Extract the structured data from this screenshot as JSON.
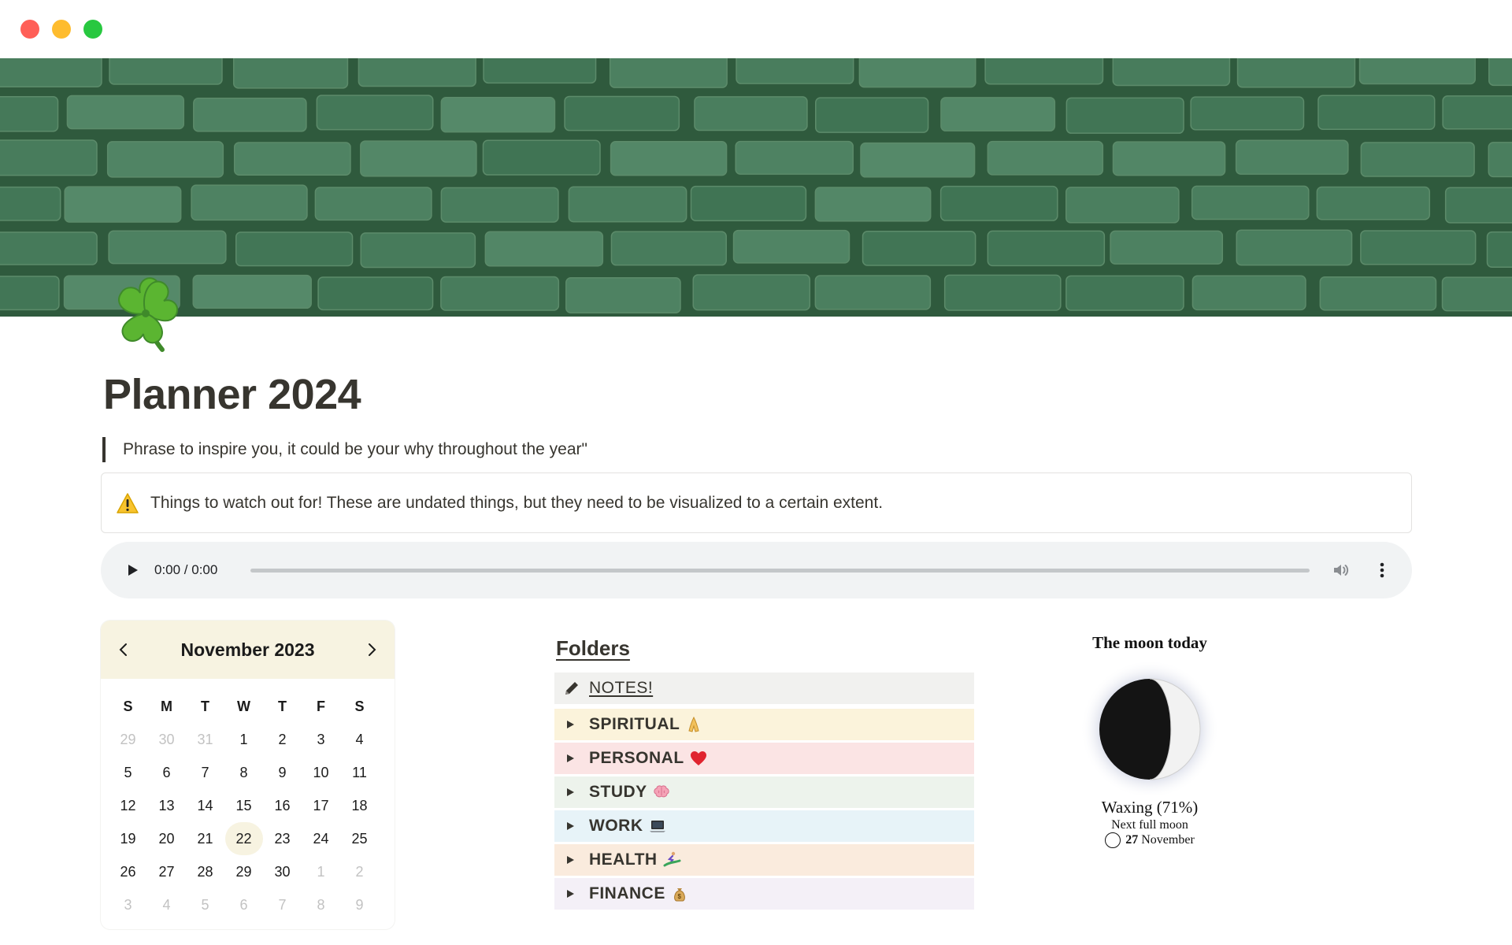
{
  "window": {
    "colors": {
      "close": "#ff5f57",
      "minimize": "#febc2e",
      "zoom": "#28c840"
    }
  },
  "cover": {
    "description_icon": "green-brick-wall-image",
    "color": "#4e7d5c"
  },
  "page": {
    "icon": "shamrock-icon",
    "title": "Planner 2024",
    "quote": "Phrase to inspire you, it could be your why throughout the year\"",
    "callout": {
      "icon": "warning-icon",
      "text": "Things to watch out for! These are undated things, but they need to be visualized to a certain extent."
    }
  },
  "audio": {
    "time": "0:00 / 0:00",
    "progress": 0
  },
  "calendar": {
    "month": "November 2023",
    "accent": "#f7f3e1",
    "weekdays": [
      "S",
      "M",
      "T",
      "W",
      "T",
      "F",
      "S"
    ],
    "days": [
      [
        "29",
        "30",
        "31",
        "1",
        "2",
        "3",
        "4"
      ],
      [
        "5",
        "6",
        "7",
        "8",
        "9",
        "10",
        "11"
      ],
      [
        "12",
        "13",
        "14",
        "15",
        "16",
        "17",
        "18"
      ],
      [
        "19",
        "20",
        "21",
        "22",
        "23",
        "24",
        "25"
      ],
      [
        "26",
        "27",
        "28",
        "29",
        "30",
        "1",
        "2"
      ],
      [
        "3",
        "4",
        "5",
        "6",
        "7",
        "8",
        "9"
      ]
    ],
    "today": "22"
  },
  "folders": {
    "title": "Folders",
    "items": [
      {
        "label": "NOTES!",
        "icon": "pencil-icon",
        "bg": "#f1f1ef"
      },
      {
        "label": "SPIRITUAL",
        "icon": "praying-hands-icon",
        "bg": "#fbf3db"
      },
      {
        "label": "PERSONAL",
        "icon": "red-heart-icon",
        "bg": "#fbe4e4"
      },
      {
        "label": "STUDY",
        "icon": "brain-icon",
        "bg": "#edf3ec"
      },
      {
        "label": "WORK",
        "icon": "laptop-icon",
        "bg": "#e7f3f8"
      },
      {
        "label": "HEALTH",
        "icon": "surfer-icon",
        "bg": "#faebdd"
      },
      {
        "label": "FINANCE",
        "icon": "money-bag-icon",
        "bg": "#f4f0f7"
      }
    ]
  },
  "moon": {
    "title": "The moon today",
    "phase": "Waxing (71%)",
    "illumination": 0.71,
    "next_label": "Next full moon",
    "next_day": "27",
    "next_month": "November"
  }
}
